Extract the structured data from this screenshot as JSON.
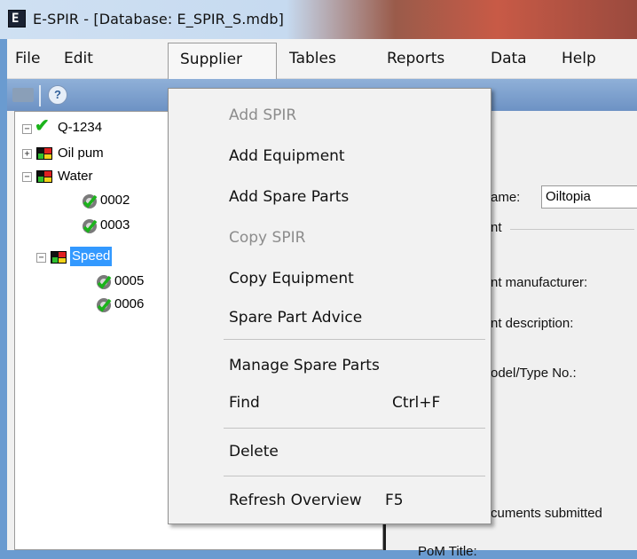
{
  "window": {
    "title": "E-SPIR - [Database: E_SPIR_S.mdb]",
    "app_icon_glyph": "E"
  },
  "menubar": {
    "items": [
      "File",
      "Edit",
      "Supplier",
      "Tables",
      "Reports",
      "Data",
      "Help"
    ],
    "open_item": "Supplier"
  },
  "toolbar": {
    "help_glyph": "?"
  },
  "tree": {
    "root": "Q-1234",
    "items": [
      {
        "label": "Oil pum"
      },
      {
        "label": "Water"
      },
      {
        "label": "0002"
      },
      {
        "label": "0003"
      },
      {
        "label": "Speed"
      },
      {
        "label": "0005"
      },
      {
        "label": "0006"
      }
    ]
  },
  "right_panel": {
    "name_label": "ame:",
    "name_value": "Oiltopia",
    "group_label": "nt",
    "fields": [
      "nt manufacturer:",
      "nt description:",
      "odel/Type No.:",
      "cuments submitted",
      "PoM Title:"
    ]
  },
  "dropdown": {
    "items": [
      {
        "label": "Add SPIR",
        "disabled": true
      },
      {
        "label": "Add Equipment",
        "disabled": false
      },
      {
        "label": "Add Spare Parts",
        "disabled": false
      },
      {
        "label": "Copy SPIR",
        "disabled": true
      },
      {
        "label": "Copy Equipment",
        "disabled": false
      },
      {
        "label": "Spare Part Advice",
        "disabled": false
      },
      {
        "label": "Manage Spare Parts",
        "disabled": false
      },
      {
        "label": "Find",
        "shortcut": "Ctrl+F",
        "disabled": false
      },
      {
        "label": "Delete",
        "disabled": false
      },
      {
        "label": "Refresh Overview",
        "shortcut": "F5",
        "disabled": false
      }
    ]
  },
  "colors": {
    "selection": "#3399ff",
    "check": "#1bb31b",
    "toolbar": "#7a9dcc"
  }
}
